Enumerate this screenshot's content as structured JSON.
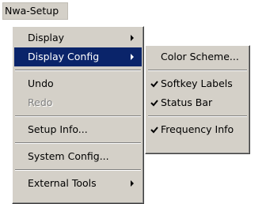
{
  "menubar": {
    "title": "Nwa-Setup"
  },
  "main_menu": {
    "items": [
      {
        "label": "Display"
      },
      {
        "label": "Display Config"
      },
      {
        "label": "Undo"
      },
      {
        "label": "Redo"
      },
      {
        "label": "Setup Info..."
      },
      {
        "label": "System Config..."
      },
      {
        "label": "External Tools"
      }
    ]
  },
  "submenu": {
    "items": [
      {
        "label": "Color Scheme..."
      },
      {
        "label": "Softkey Labels"
      },
      {
        "label": "Status Bar"
      },
      {
        "label": "Frequency Info"
      }
    ]
  },
  "colors": {
    "highlight": "#0a246a",
    "menu_bg": "#d4d0c8",
    "disabled": "#808080"
  },
  "icons": {
    "submenu_arrow": "triangle-right-icon",
    "checkmark": "check-icon"
  }
}
